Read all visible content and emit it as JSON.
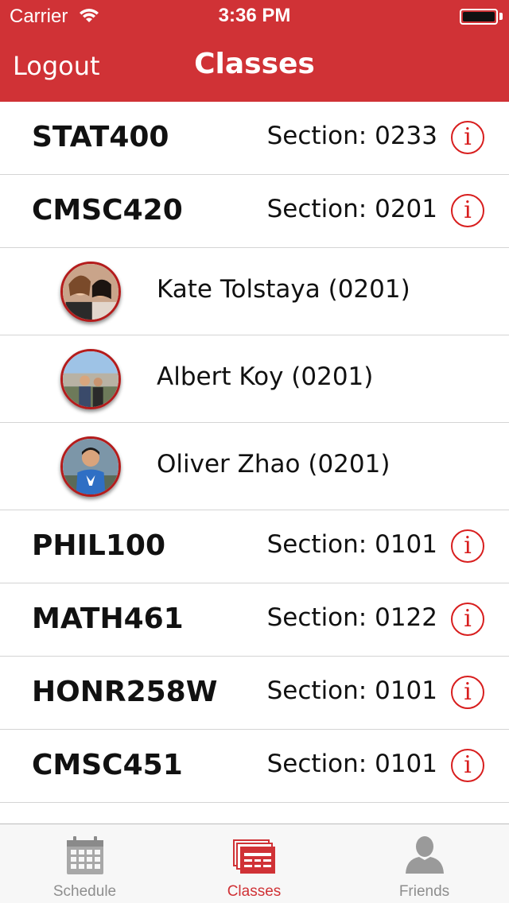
{
  "status_bar": {
    "carrier": "Carrier",
    "time": "3:36 PM"
  },
  "nav": {
    "left_label": "Logout",
    "title": "Classes"
  },
  "classes": [
    {
      "code": "STAT400",
      "section": "Section: 0233"
    },
    {
      "code": "CMSC420",
      "section": "Section: 0201"
    },
    {
      "code": "PHIL100",
      "section": "Section: 0101"
    },
    {
      "code": "MATH461",
      "section": "Section: 0122"
    },
    {
      "code": "HONR258W",
      "section": "Section: 0101"
    },
    {
      "code": "CMSC451",
      "section": "Section: 0101"
    }
  ],
  "friends": [
    {
      "name": "Kate Tolstaya (0201)"
    },
    {
      "name": "Albert Koy (0201)"
    },
    {
      "name": "Oliver Zhao (0201)"
    }
  ],
  "tabs": [
    {
      "label": "Schedule",
      "icon": "calendar-icon",
      "active": false
    },
    {
      "label": "Classes",
      "icon": "classes-icon",
      "active": true
    },
    {
      "label": "Friends",
      "icon": "person-icon",
      "active": false
    }
  ],
  "colors": {
    "brand": "#d03236",
    "info": "#d81e1e",
    "tab_inactive": "#8e8e8e"
  }
}
